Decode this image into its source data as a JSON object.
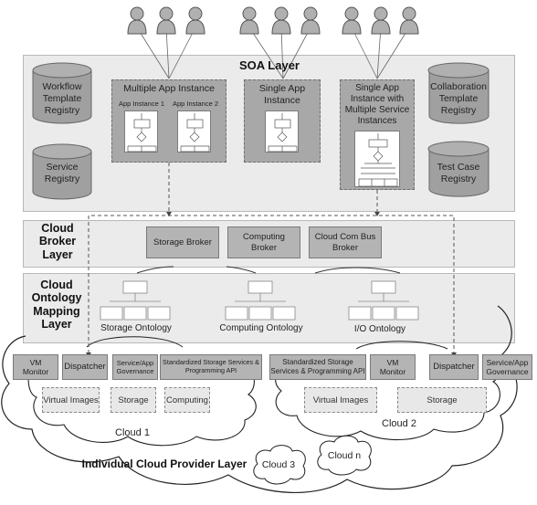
{
  "soa_layer": {
    "title": "SOA Layer",
    "registries": [
      {
        "id": "workflow",
        "label": "Workflow Template Registry",
        "lines": [
          "Workflow",
          "Template",
          "Registry"
        ]
      },
      {
        "id": "service",
        "label": "Service Registry",
        "lines": [
          "Service",
          "Registry"
        ]
      },
      {
        "id": "collaboration",
        "label": "Collaboration Template Registry",
        "lines": [
          "Collaboration",
          "Template",
          "Registry"
        ]
      },
      {
        "id": "testcase",
        "label": "Test Case Registry",
        "lines": [
          "Test Case",
          "Registry"
        ]
      }
    ],
    "instances": {
      "multiple": {
        "title": "Multiple App Instance",
        "sub": [
          "App Instance 1",
          "App Instance 2"
        ]
      },
      "single": {
        "title_lines": [
          "Single App",
          "Instance"
        ]
      },
      "single_multi_service": {
        "title_lines": [
          "Single App",
          "Instance with",
          "Multiple Service",
          "Instances"
        ]
      }
    },
    "user_groups": 3,
    "users_per_group": 3
  },
  "broker_layer": {
    "title_lines": [
      "Cloud",
      "Broker",
      "Layer"
    ],
    "brokers": [
      {
        "lines": [
          "Storage Broker"
        ]
      },
      {
        "lines": [
          "Computing",
          "Broker"
        ]
      },
      {
        "lines": [
          "Cloud Com Bus",
          "Broker"
        ]
      }
    ]
  },
  "ontology_layer": {
    "title_lines": [
      "Cloud",
      "Ontology",
      "Mapping",
      "Layer"
    ],
    "ontologies": [
      "Storage Ontology",
      "Computing Ontology",
      "I/O Ontology"
    ]
  },
  "provider_layer": {
    "title": "Individual Cloud Provider Layer",
    "cloud1": {
      "label": "Cloud 1",
      "components": [
        {
          "lines": [
            "VM",
            "Monitor"
          ]
        },
        {
          "lines": [
            "Dispatcher"
          ]
        },
        {
          "lines": [
            "Service/App",
            "Governance"
          ]
        },
        {
          "lines": [
            "Standardized Storage Services &",
            "Programming API"
          ]
        }
      ],
      "resources": [
        "Virtual Images",
        "Storage",
        "Computing"
      ]
    },
    "cloud2": {
      "label": "Cloud 2",
      "components": [
        {
          "lines": [
            "Standardized Storage",
            "Services & Programming API"
          ]
        },
        {
          "lines": [
            "VM",
            "Monitor"
          ]
        },
        {
          "lines": [
            "Dispatcher"
          ]
        },
        {
          "lines": [
            "Service/App",
            "Governance"
          ]
        }
      ],
      "resources": [
        "Virtual Images",
        "Storage"
      ]
    },
    "other_clouds": [
      "Cloud 3",
      "Cloud n"
    ]
  },
  "colors": {
    "layer_bg": "#ebebeb",
    "box_fill": "#a8a8a8",
    "cylinder_fill": "#a0a0a0",
    "line": "#555555"
  }
}
